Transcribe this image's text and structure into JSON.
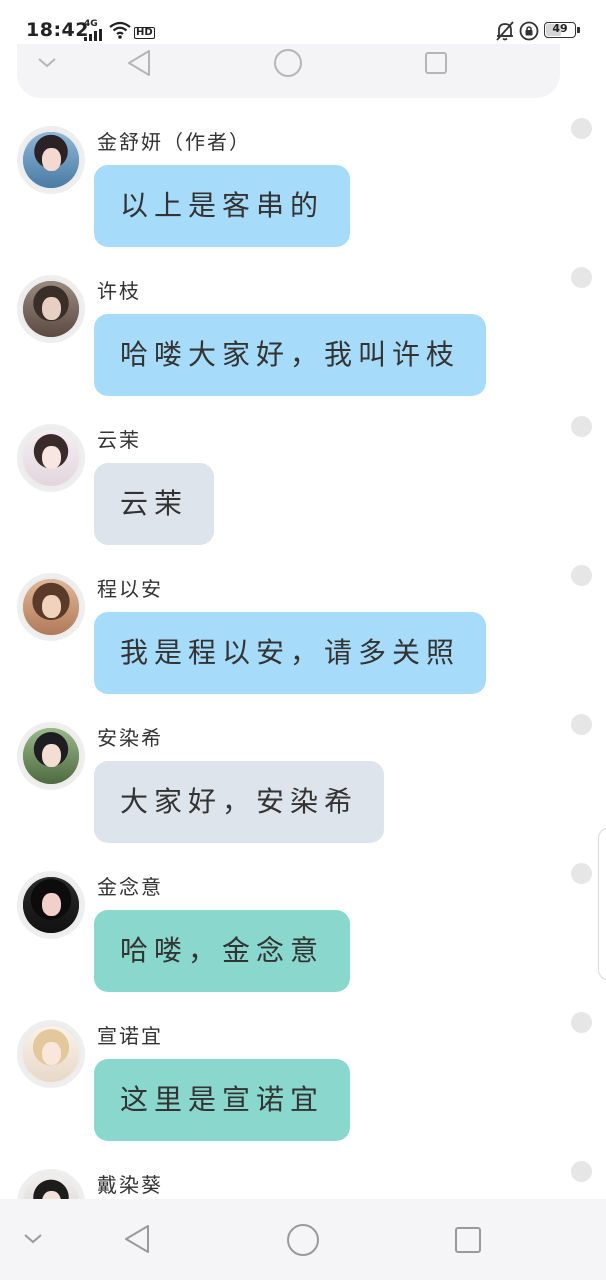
{
  "status_bar": {
    "time": "18:42",
    "network": "4G",
    "hd_label": "HD",
    "battery_level": "49",
    "battery_fraction": 0.49,
    "icons": [
      "signal-icon",
      "wifi-icon",
      "bell-off-icon",
      "lock-rotation-icon",
      "battery-icon"
    ]
  },
  "top_nav": {
    "buttons": [
      "chevron-down-icon",
      "back-triangle-icon",
      "home-circle-icon",
      "recents-square-icon"
    ]
  },
  "messages": [
    {
      "sender": "金舒妍（作者）",
      "text": "以上是客串的",
      "style": "blue"
    },
    {
      "sender": "许枝",
      "text": "哈喽大家好，我叫许枝",
      "style": "blue"
    },
    {
      "sender": "云茉",
      "text": "云茉",
      "style": "gray"
    },
    {
      "sender": "程以安",
      "text": "我是程以安，请多关照",
      "style": "blue"
    },
    {
      "sender": "安染希",
      "text": "大家好，安染希",
      "style": "gray"
    },
    {
      "sender": "金念意",
      "text": "哈喽，金念意",
      "style": "teal"
    },
    {
      "sender": "宣诺宜",
      "text": "这里是宣诺宜",
      "style": "teal"
    },
    {
      "sender": "戴染葵",
      "text": "",
      "style": "none"
    }
  ],
  "bottom_nav": {
    "buttons": [
      "chevron-down-icon",
      "back-triangle-icon",
      "home-circle-icon",
      "recents-square-icon"
    ]
  },
  "colors": {
    "bubble_blue": "#a6dcfa",
    "bubble_gray": "#dee4ec",
    "bubble_teal": "#8ad7cd",
    "nav_background": "#f5f5f7"
  }
}
